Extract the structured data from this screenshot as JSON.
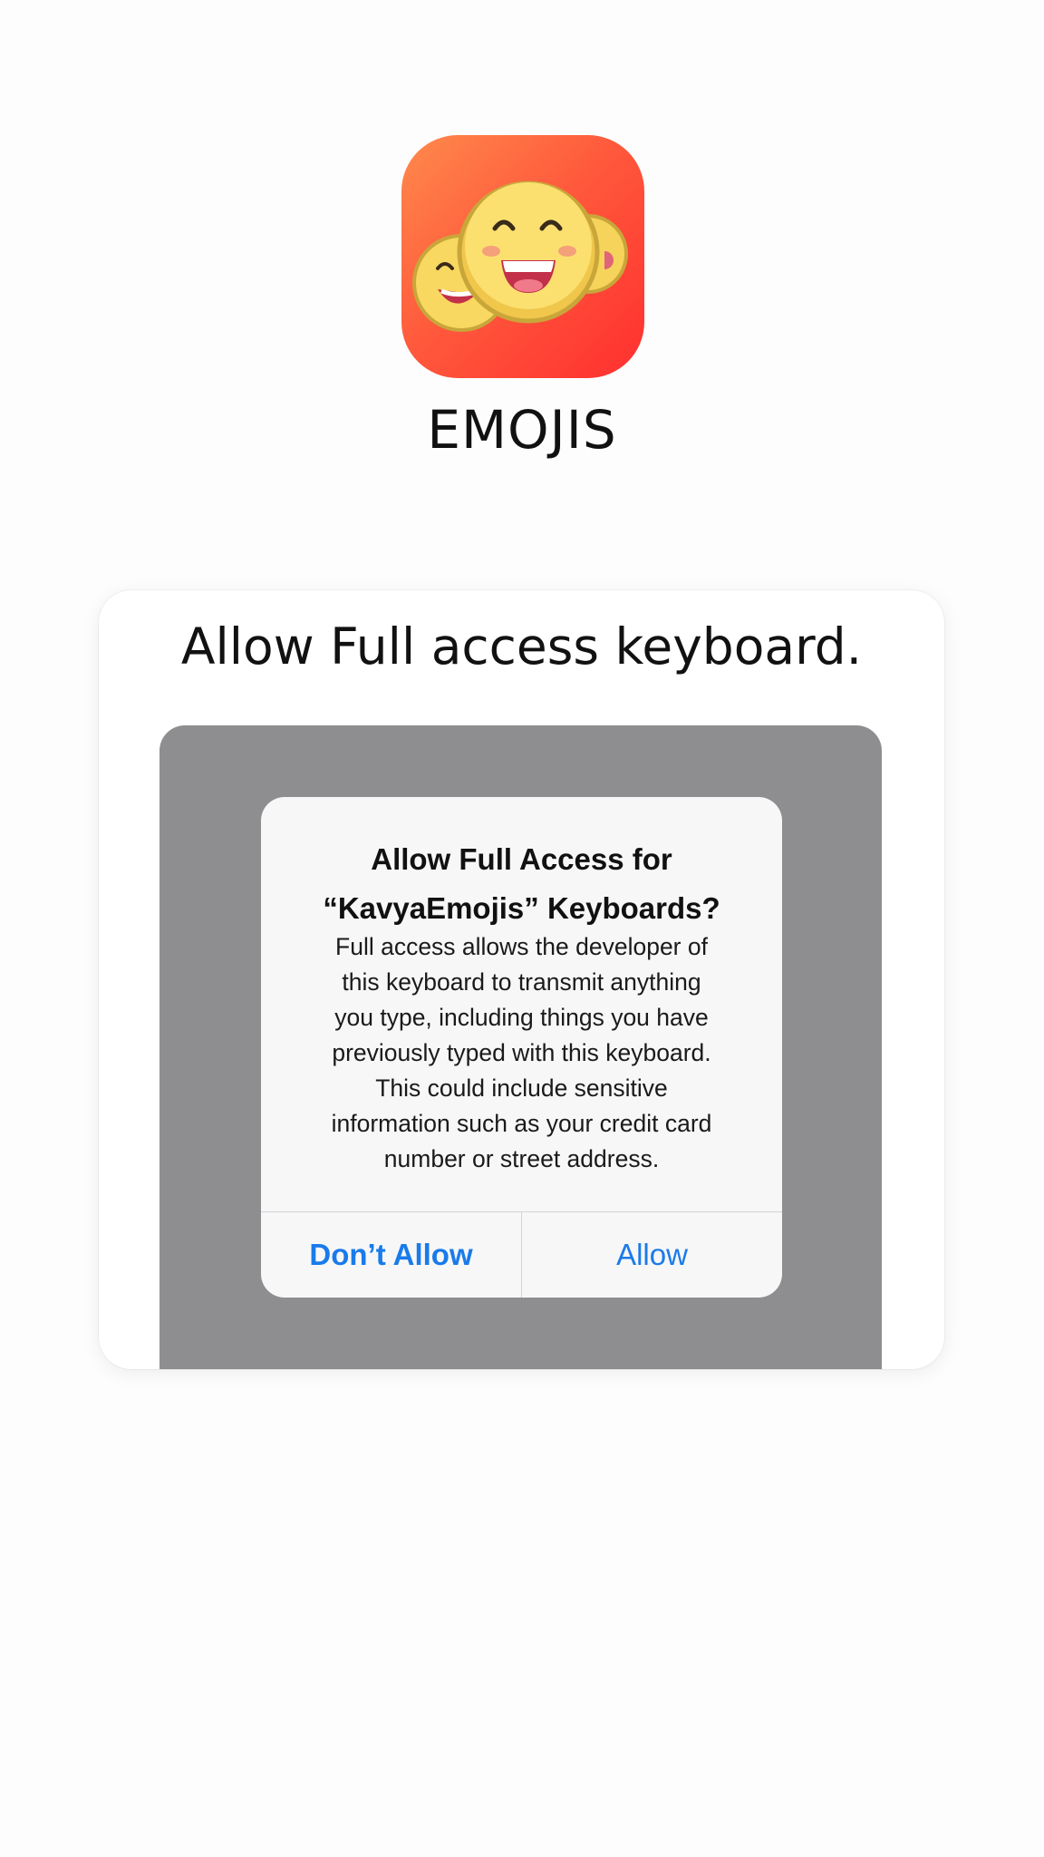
{
  "app": {
    "name": "EMOJIS",
    "icon": "smiling-faces-app-icon"
  },
  "card": {
    "title": "Allow Full access keyboard."
  },
  "alert": {
    "title_line1": "Allow Full Access for",
    "title_line2": "“KavyaEmojis” Keyboards?",
    "message_lines": [
      "Full access allows the developer of",
      "this keyboard to transmit anything",
      "you type, including things you have",
      "previously typed with this keyboard.",
      "This could include sensitive",
      "information such as your credit card",
      "number or street address."
    ],
    "dont_allow_label": "Don’t Allow",
    "allow_label": "Allow"
  },
  "colors": {
    "button_blue": "#1a7bea",
    "dim_overlay": "#8e8e90",
    "icon_gradient_start": "#ff8a4c",
    "icon_gradient_end": "#ff2f2f"
  }
}
